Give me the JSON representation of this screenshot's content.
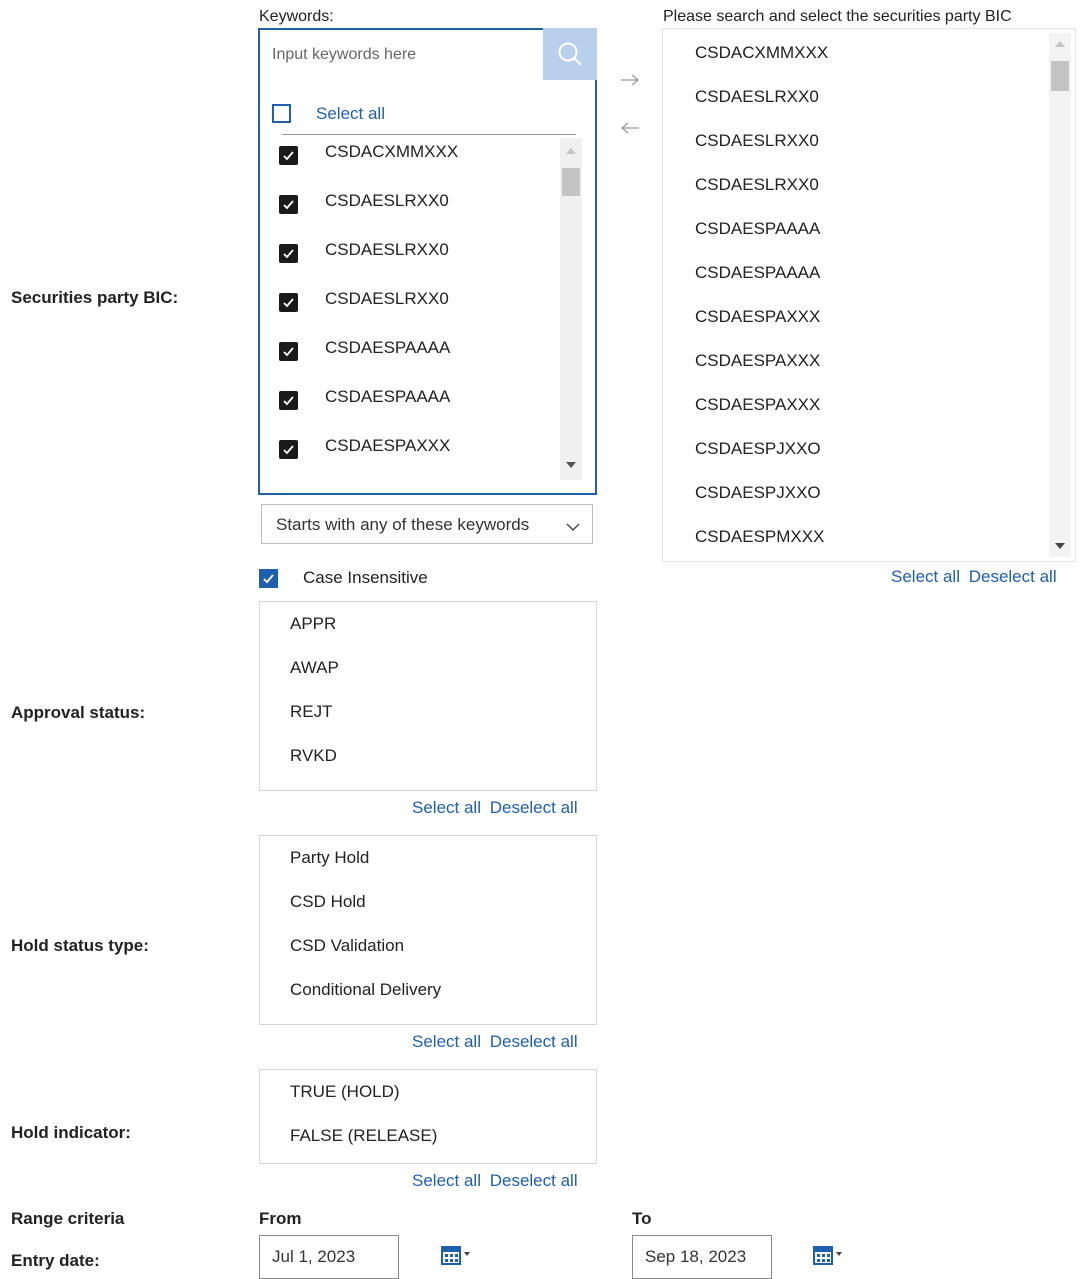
{
  "labels": {
    "securities_party_bic": "Securities party BIC:",
    "approval_status": "Approval status:",
    "hold_status_type": "Hold status type:",
    "hold_indicator": "Hold indicator:",
    "range_criteria": "Range criteria",
    "entry_date": "Entry date:"
  },
  "keywords": {
    "caption": "Keywords:",
    "placeholder": "Input keywords here",
    "select_all_label": "Select all",
    "items": [
      {
        "label": "CSDACXMMXXX",
        "checked": true
      },
      {
        "label": "CSDAESLRXX0",
        "checked": true
      },
      {
        "label": "CSDAESLRXX0",
        "checked": true
      },
      {
        "label": "CSDAESLRXX0",
        "checked": true
      },
      {
        "label": "CSDAESPAAAA",
        "checked": true
      },
      {
        "label": "CSDAESPAAAA",
        "checked": true
      },
      {
        "label": "CSDAESPAXXX",
        "checked": true
      }
    ],
    "match_type": "Starts with any of these keywords",
    "case_insensitive_label": "Case Insensitive",
    "case_insensitive_checked": true
  },
  "available": {
    "caption": "Please search and select the securities party BIC",
    "items": [
      "CSDACXMMXXX",
      "CSDAESLRXX0",
      "CSDAESLRXX0",
      "CSDAESLRXX0",
      "CSDAESPAAAA",
      "CSDAESPAAAA",
      "CSDAESPAXXX",
      "CSDAESPAXXX",
      "CSDAESPAXXX",
      "CSDAESPJXXO",
      "CSDAESPJXXO",
      "CSDAESPMXXX"
    ],
    "select_all": "Select all",
    "deselect_all": "Deselect all"
  },
  "approval_status": {
    "options": [
      "APPR",
      "AWAP",
      "REJT",
      "RVKD"
    ],
    "select_all": "Select all",
    "deselect_all": "Deselect all"
  },
  "hold_status_type": {
    "options": [
      "Party Hold",
      "CSD Hold",
      "CSD Validation",
      "Conditional Delivery"
    ],
    "select_all": "Select all",
    "deselect_all": "Deselect all"
  },
  "hold_indicator": {
    "options": [
      "TRUE (HOLD)",
      "FALSE (RELEASE)"
    ],
    "select_all": "Select all",
    "deselect_all": "Deselect all"
  },
  "range": {
    "from_label": "From",
    "to_label": "To",
    "from_value": "Jul 1, 2023",
    "to_value": "Sep 18, 2023"
  },
  "colors": {
    "accent": "#1f5fb0",
    "search_button": "#b9d0ec"
  }
}
